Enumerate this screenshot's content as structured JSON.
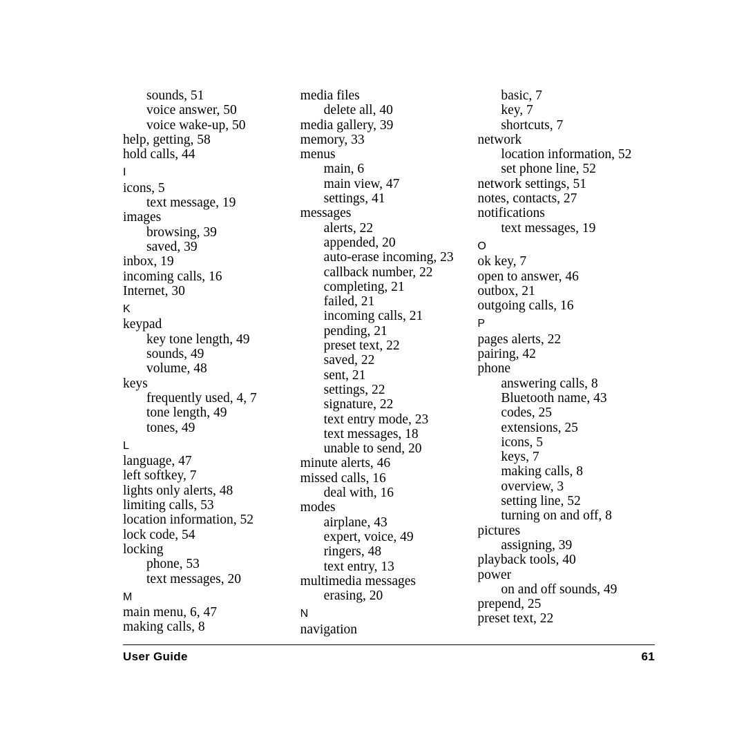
{
  "document": {
    "footer_left": "User Guide",
    "page_number": "61"
  },
  "columns": [
    {
      "entries": [
        {
          "level": 2,
          "text": "sounds, 51"
        },
        {
          "level": 2,
          "text": "voice answer, 50"
        },
        {
          "level": 2,
          "text": "voice wake-up, 50"
        },
        {
          "level": 1,
          "text": "help, getting, 58"
        },
        {
          "level": 1,
          "text": "hold calls, 44"
        },
        {
          "level": 0,
          "text": "I"
        },
        {
          "level": 1,
          "text": "icons, 5"
        },
        {
          "level": 2,
          "text": "text message, 19"
        },
        {
          "level": 1,
          "text": "images"
        },
        {
          "level": 2,
          "text": "browsing, 39"
        },
        {
          "level": 2,
          "text": "saved, 39"
        },
        {
          "level": 1,
          "text": "inbox, 19"
        },
        {
          "level": 1,
          "text": "incoming calls, 16"
        },
        {
          "level": 1,
          "text": "Internet, 30"
        },
        {
          "level": 0,
          "text": "K"
        },
        {
          "level": 1,
          "text": "keypad"
        },
        {
          "level": 2,
          "text": "key tone length, 49"
        },
        {
          "level": 2,
          "text": "sounds, 49"
        },
        {
          "level": 2,
          "text": "volume, 48"
        },
        {
          "level": 1,
          "text": "keys"
        },
        {
          "level": 2,
          "text": "frequently used, 4, 7"
        },
        {
          "level": 2,
          "text": "tone length, 49"
        },
        {
          "level": 2,
          "text": "tones, 49"
        },
        {
          "level": 0,
          "text": "L"
        },
        {
          "level": 1,
          "text": "language, 47"
        },
        {
          "level": 1,
          "text": "left softkey, 7"
        },
        {
          "level": 1,
          "text": "lights only alerts, 48"
        },
        {
          "level": 1,
          "text": "limiting calls, 53"
        },
        {
          "level": 1,
          "text": "location information, 52"
        },
        {
          "level": 1,
          "text": "lock code, 54"
        },
        {
          "level": 1,
          "text": "locking"
        },
        {
          "level": 2,
          "text": "phone, 53"
        },
        {
          "level": 2,
          "text": "text messages, 20"
        },
        {
          "level": 0,
          "text": "M"
        },
        {
          "level": 1,
          "text": "main menu, 6, 47"
        },
        {
          "level": 1,
          "text": "making calls, 8"
        }
      ]
    },
    {
      "entries": [
        {
          "level": 1,
          "text": "media files"
        },
        {
          "level": 2,
          "text": "delete all, 40"
        },
        {
          "level": 1,
          "text": "media gallery, 39"
        },
        {
          "level": 1,
          "text": "memory, 33"
        },
        {
          "level": 1,
          "text": "menus"
        },
        {
          "level": 2,
          "text": "main, 6"
        },
        {
          "level": 2,
          "text": "main view, 47"
        },
        {
          "level": 2,
          "text": "settings, 41"
        },
        {
          "level": 1,
          "text": "messages"
        },
        {
          "level": 2,
          "text": "alerts, 22"
        },
        {
          "level": 2,
          "text": "appended, 20"
        },
        {
          "level": 2,
          "text": "auto-erase incoming, 23"
        },
        {
          "level": 2,
          "text": "callback number, 22"
        },
        {
          "level": 2,
          "text": "completing, 21"
        },
        {
          "level": 2,
          "text": "failed, 21"
        },
        {
          "level": 2,
          "text": "incoming calls, 21"
        },
        {
          "level": 2,
          "text": "pending, 21"
        },
        {
          "level": 2,
          "text": "preset text, 22"
        },
        {
          "level": 2,
          "text": "saved, 22"
        },
        {
          "level": 2,
          "text": "sent, 21"
        },
        {
          "level": 2,
          "text": "settings, 22"
        },
        {
          "level": 2,
          "text": "signature, 22"
        },
        {
          "level": 2,
          "text": "text entry mode, 23"
        },
        {
          "level": 2,
          "text": "text messages, 18"
        },
        {
          "level": 2,
          "text": "unable to send, 20"
        },
        {
          "level": 1,
          "text": "minute alerts, 46"
        },
        {
          "level": 1,
          "text": "missed calls, 16"
        },
        {
          "level": 2,
          "text": "deal with, 16"
        },
        {
          "level": 1,
          "text": "modes"
        },
        {
          "level": 2,
          "text": "airplane, 43"
        },
        {
          "level": 2,
          "text": "expert, voice, 49"
        },
        {
          "level": 2,
          "text": "ringers, 48"
        },
        {
          "level": 2,
          "text": "text entry, 13"
        },
        {
          "level": 1,
          "text": "multimedia messages"
        },
        {
          "level": 2,
          "text": "erasing, 20"
        },
        {
          "level": 0,
          "text": "N"
        },
        {
          "level": 1,
          "text": "navigation"
        }
      ]
    },
    {
      "entries": [
        {
          "level": 2,
          "text": "basic, 7"
        },
        {
          "level": 2,
          "text": "key, 7"
        },
        {
          "level": 2,
          "text": "shortcuts, 7"
        },
        {
          "level": 1,
          "text": "network"
        },
        {
          "level": 2,
          "text": "location information, 52"
        },
        {
          "level": 2,
          "text": "set phone line, 52"
        },
        {
          "level": 1,
          "text": "network settings, 51"
        },
        {
          "level": 1,
          "text": "notes, contacts, 27"
        },
        {
          "level": 1,
          "text": "notifications"
        },
        {
          "level": 2,
          "text": "text messages, 19"
        },
        {
          "level": 0,
          "text": "O"
        },
        {
          "level": 1,
          "text": "ok key, 7"
        },
        {
          "level": 1,
          "text": "open to answer, 46"
        },
        {
          "level": 1,
          "text": "outbox, 21"
        },
        {
          "level": 1,
          "text": "outgoing calls, 16"
        },
        {
          "level": 0,
          "text": "P"
        },
        {
          "level": 1,
          "text": "pages alerts, 22"
        },
        {
          "level": 1,
          "text": "pairing, 42"
        },
        {
          "level": 1,
          "text": "phone"
        },
        {
          "level": 2,
          "text": "answering calls, 8"
        },
        {
          "level": 2,
          "text": "Bluetooth name, 43"
        },
        {
          "level": 2,
          "text": "codes, 25"
        },
        {
          "level": 2,
          "text": "extensions, 25"
        },
        {
          "level": 2,
          "text": "icons, 5"
        },
        {
          "level": 2,
          "text": "keys, 7"
        },
        {
          "level": 2,
          "text": "making calls, 8"
        },
        {
          "level": 2,
          "text": "overview, 3"
        },
        {
          "level": 2,
          "text": "setting line, 52"
        },
        {
          "level": 2,
          "text": "turning on and off, 8"
        },
        {
          "level": 1,
          "text": "pictures"
        },
        {
          "level": 2,
          "text": "assigning, 39"
        },
        {
          "level": 1,
          "text": "playback tools, 40"
        },
        {
          "level": 1,
          "text": "power"
        },
        {
          "level": 2,
          "text": "on and off sounds, 49"
        },
        {
          "level": 1,
          "text": "prepend, 25"
        },
        {
          "level": 1,
          "text": "preset text, 22"
        }
      ]
    }
  ]
}
